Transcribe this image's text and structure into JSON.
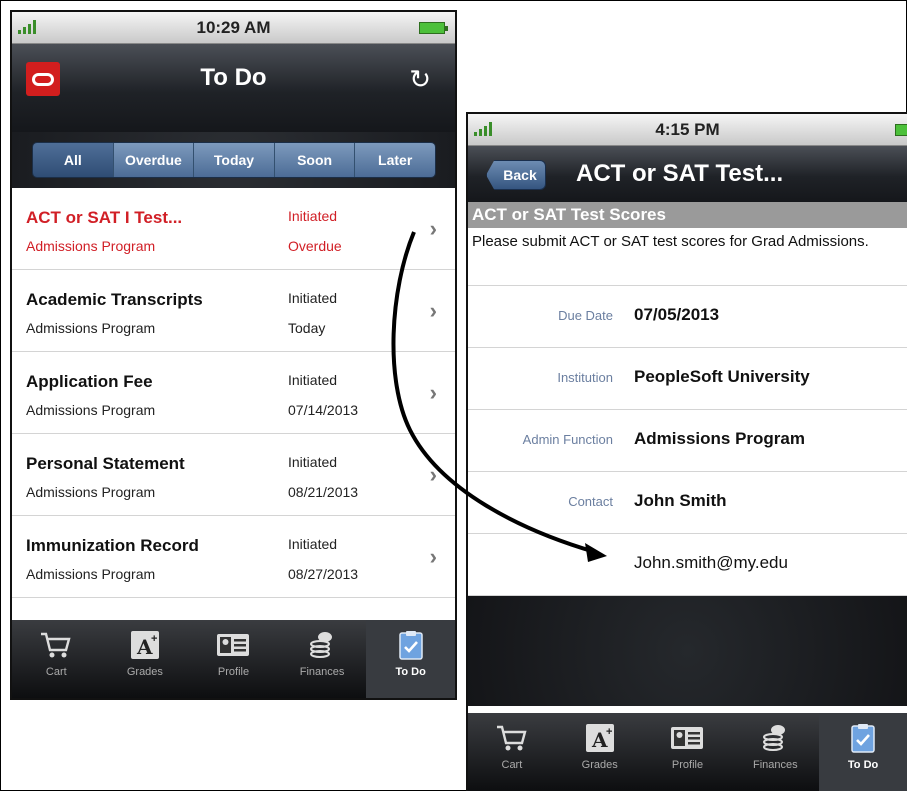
{
  "phone1": {
    "status_time": "10:29 AM",
    "title": "To Do",
    "segments": [
      "All",
      "Overdue",
      "Today",
      "Soon",
      "Later"
    ],
    "active_segment": "All",
    "items": [
      {
        "title": "ACT or SAT I Test...",
        "program": "Admissions Program",
        "status": "Initiated",
        "due": "Overdue",
        "overdue": true
      },
      {
        "title": "Academic Transcripts",
        "program": "Admissions Program",
        "status": "Initiated",
        "due": "Today",
        "overdue": false
      },
      {
        "title": "Application Fee",
        "program": "Admissions Program",
        "status": "Initiated",
        "due": "07/14/2013",
        "overdue": false
      },
      {
        "title": "Personal Statement",
        "program": "Admissions Program",
        "status": "Initiated",
        "due": "08/21/2013",
        "overdue": false
      },
      {
        "title": "Immunization Record",
        "program": "Admissions Program",
        "status": "Initiated",
        "due": "08/27/2013",
        "overdue": false
      }
    ]
  },
  "phone2": {
    "status_time": "4:15 PM",
    "back_label": "Back",
    "title": "ACT or SAT Test...",
    "section_title": "ACT or SAT Test Scores",
    "description": "Please submit ACT or SAT test scores for  Grad Admissions.",
    "details": [
      {
        "label": "Due Date",
        "value": "07/05/2013"
      },
      {
        "label": "Institution",
        "value": "PeopleSoft University"
      },
      {
        "label": "Admin Function",
        "value": "Admissions Program"
      },
      {
        "label": "Contact",
        "value": "John Smith"
      },
      {
        "label": "",
        "value": "John.smith@my.edu"
      }
    ]
  },
  "tabs": [
    {
      "label": "Cart",
      "icon": "cart-icon"
    },
    {
      "label": "Grades",
      "icon": "grades-icon"
    },
    {
      "label": "Profile",
      "icon": "profile-icon"
    },
    {
      "label": "Finances",
      "icon": "finances-icon"
    },
    {
      "label": "To Do",
      "icon": "todo-icon",
      "active": true
    }
  ],
  "colors": {
    "overdue": "#d11f26",
    "segment": "#5b7aa3",
    "nav_dark": "#1f2227",
    "oracle_red": "#d21e1e"
  }
}
